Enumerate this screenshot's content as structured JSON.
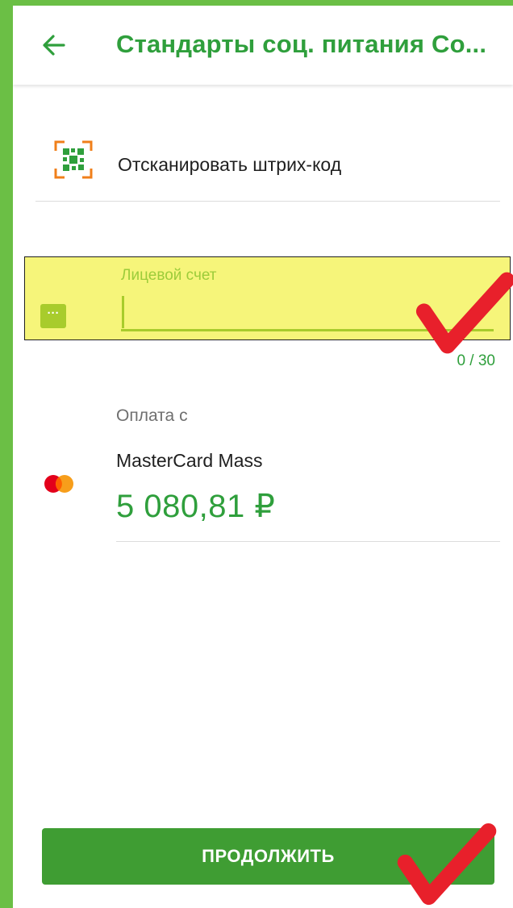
{
  "header": {
    "title": "Стандарты соц. питания Со...",
    "back_icon": "arrow-left-icon"
  },
  "scan": {
    "icon": "qr-scan-icon",
    "label": "Отсканировать штрих-код"
  },
  "account_field": {
    "label": "Лицевой счет",
    "value": "",
    "counter": "0 / 30",
    "more_icon": "more-dots-icon",
    "more_text": "···"
  },
  "payment": {
    "label": "Оплата с",
    "card_name": "MasterCard Mass",
    "balance": "5 080,81 ₽",
    "card_icon": "mastercard-icon"
  },
  "actions": {
    "continue_label": "ПРОДОЛЖИТЬ"
  },
  "colors": {
    "brand_green": "#2f9f3c",
    "button_green": "#3f9d33",
    "frame_green": "#6bbf45",
    "highlight_yellow": "#f6f57a",
    "field_accent": "#a8cc2c",
    "annotation_red": "#e8202b"
  }
}
